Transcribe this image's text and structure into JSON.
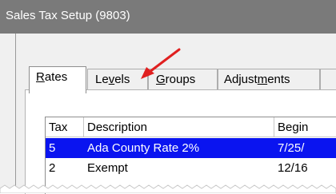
{
  "window": {
    "title": "Sales Tax Setup (9803)"
  },
  "tabs": [
    {
      "label_parts": [
        "",
        "R",
        "ates"
      ],
      "selected": true
    },
    {
      "label_parts": [
        "Le",
        "v",
        "els"
      ],
      "selected": false
    },
    {
      "label_parts": [
        "",
        "G",
        "roups"
      ],
      "selected": false
    },
    {
      "label_parts": [
        "Adjust",
        "m",
        "ents"
      ],
      "selected": false
    }
  ],
  "grid": {
    "columns": [
      "Tax",
      "Description",
      "Begin"
    ],
    "rows": [
      {
        "tax": "5",
        "description": "Ada County Rate 2%",
        "begin": "7/25/",
        "selected": true
      },
      {
        "tax": "2",
        "description": "Exempt",
        "begin": "12/16",
        "selected": false
      }
    ]
  },
  "colors": {
    "titlebar": "#7a7a7a",
    "selection": "#0a14f0",
    "annotation_arrow": "#e02020"
  },
  "annotation": {
    "arrow_icon": "red-arrow-icon",
    "points_to": "tab-levels"
  }
}
